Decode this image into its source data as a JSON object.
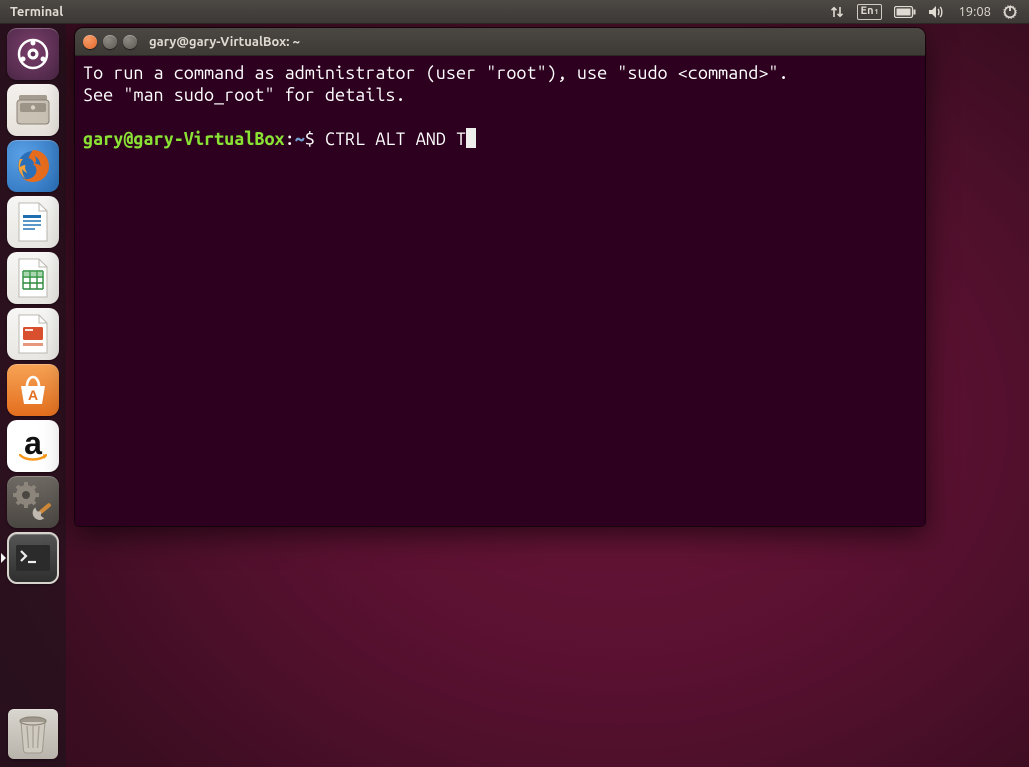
{
  "top_panel": {
    "app_title": "Terminal",
    "language_code": "En",
    "language_sub": "1",
    "clock": "19:08"
  },
  "launcher": {
    "items": [
      {
        "name": "dash",
        "label": "Dash"
      },
      {
        "name": "files",
        "label": "Files"
      },
      {
        "name": "firefox",
        "label": "Firefox"
      },
      {
        "name": "writer",
        "label": "LibreOffice Writer"
      },
      {
        "name": "calc",
        "label": "LibreOffice Calc"
      },
      {
        "name": "impress",
        "label": "LibreOffice Impress"
      },
      {
        "name": "software-center",
        "label": "Ubuntu Software"
      },
      {
        "name": "amazon",
        "label": "Amazon"
      },
      {
        "name": "settings",
        "label": "System Settings"
      },
      {
        "name": "terminal",
        "label": "Terminal"
      }
    ],
    "trash_label": "Trash"
  },
  "terminal": {
    "title": "gary@gary-VirtualBox: ~",
    "motd_line1": "To run a command as administrator (user \"root\"), use \"sudo <command>\".",
    "motd_line2": "See \"man sudo_root\" for details.",
    "prompt_user": "gary@gary-VirtualBox",
    "prompt_sep": ":",
    "prompt_path": "~",
    "prompt_symbol": "$",
    "typed_command": "CTRL ALT AND T"
  }
}
